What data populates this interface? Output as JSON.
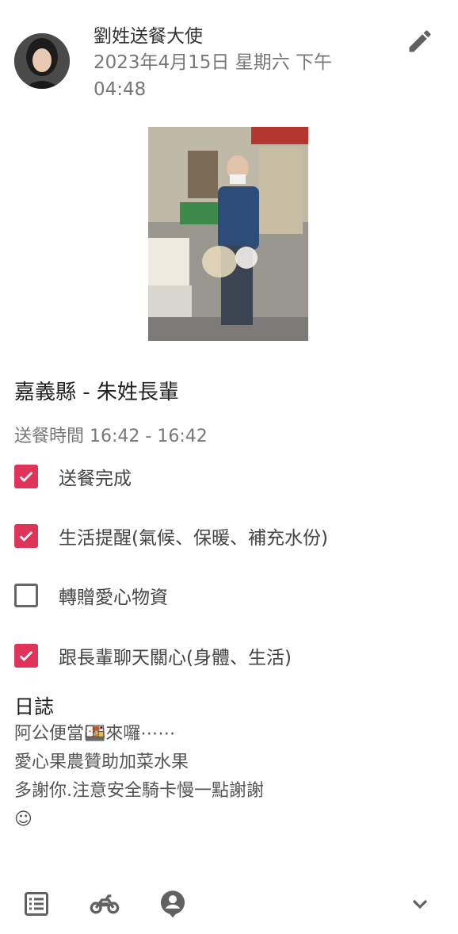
{
  "post": {
    "author": "劉姓送餐大使",
    "date": "2023年4月15日 星期六 下午 04:48",
    "recipient": "嘉義縣 - 朱姓長輩",
    "delivery_time": "送餐時間 16:42 - 16:42"
  },
  "checklist": [
    {
      "label": "送餐完成",
      "checked": true
    },
    {
      "label": "生活提醒(氣候、保暖、補充水份)",
      "checked": true
    },
    {
      "label": "轉贈愛心物資",
      "checked": false
    },
    {
      "label": "跟長輩聊天關心(身體、生活)",
      "checked": true
    }
  ],
  "journal": {
    "title": "日誌",
    "lines": [
      "阿公便當🍱來囉⋯⋯",
      "愛心果農贊助加菜水果",
      "多謝你.注意安全騎卡慢一點謝謝",
      "☺"
    ]
  },
  "icons": {
    "edit": "edit-pencil-icon",
    "list": "list-icon",
    "bike": "motorcycle-icon",
    "location": "person-pin-icon",
    "expand": "chevron-down-icon"
  },
  "colors": {
    "checkbox_checked": "#e0335a",
    "icon_gray": "#616161"
  }
}
